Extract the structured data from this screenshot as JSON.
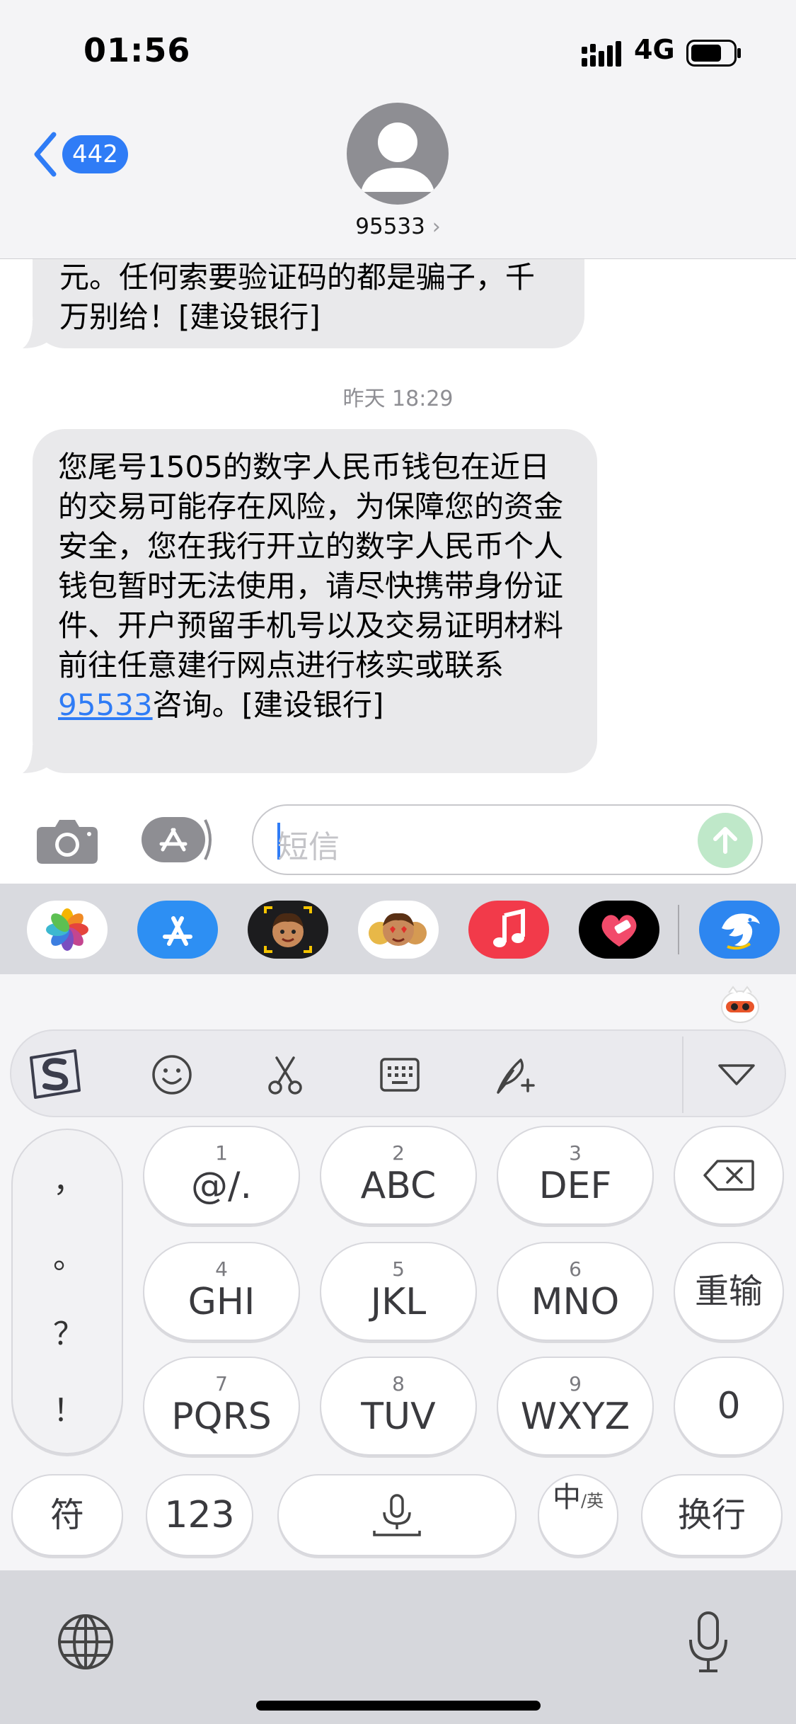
{
  "status_bar": {
    "time": "01:56",
    "network": "4G"
  },
  "header": {
    "back_badge": "442",
    "contact": "95533",
    "contact_chevron": "›"
  },
  "messages": {
    "prev_text": "元。任何索要验证码的都是骗子，千万别给！[建设银行]",
    "timestamp": "昨天 18:29",
    "main_before": "您尾号1505的数字人民币钱包在近日的交易可能存在风险，为保障您的资金安全，您在我行开立的数字人民币个人钱包暂时无法使用，请尽快携带身份证件、开户预留手机号以及交易证明材料前往任意建行网点进行核实或联系",
    "main_link": "95533",
    "main_after": "咨询。[建设银行]"
  },
  "input": {
    "placeholder": "短信"
  },
  "keyboard": {
    "punctuation": [
      "，",
      "。",
      "？",
      "！"
    ],
    "keys": [
      {
        "num": "1",
        "label": "@/."
      },
      {
        "num": "2",
        "label": "ABC"
      },
      {
        "num": "3",
        "label": "DEF"
      },
      {
        "num": "4",
        "label": "GHI"
      },
      {
        "num": "5",
        "label": "JKL"
      },
      {
        "num": "6",
        "label": "MNO"
      },
      {
        "num": "7",
        "label": "PQRS"
      },
      {
        "num": "8",
        "label": "TUV"
      },
      {
        "num": "9",
        "label": "WXYZ"
      }
    ],
    "reinput": "重输",
    "zero": "0",
    "symbols": "符",
    "numbers": "123",
    "lang_main": "中",
    "lang_sub": "/英",
    "newline": "换行"
  },
  "colors": {
    "accent": "#2f7cf6",
    "bubble": "#e9e9eb",
    "send": "#bfe8c9"
  }
}
